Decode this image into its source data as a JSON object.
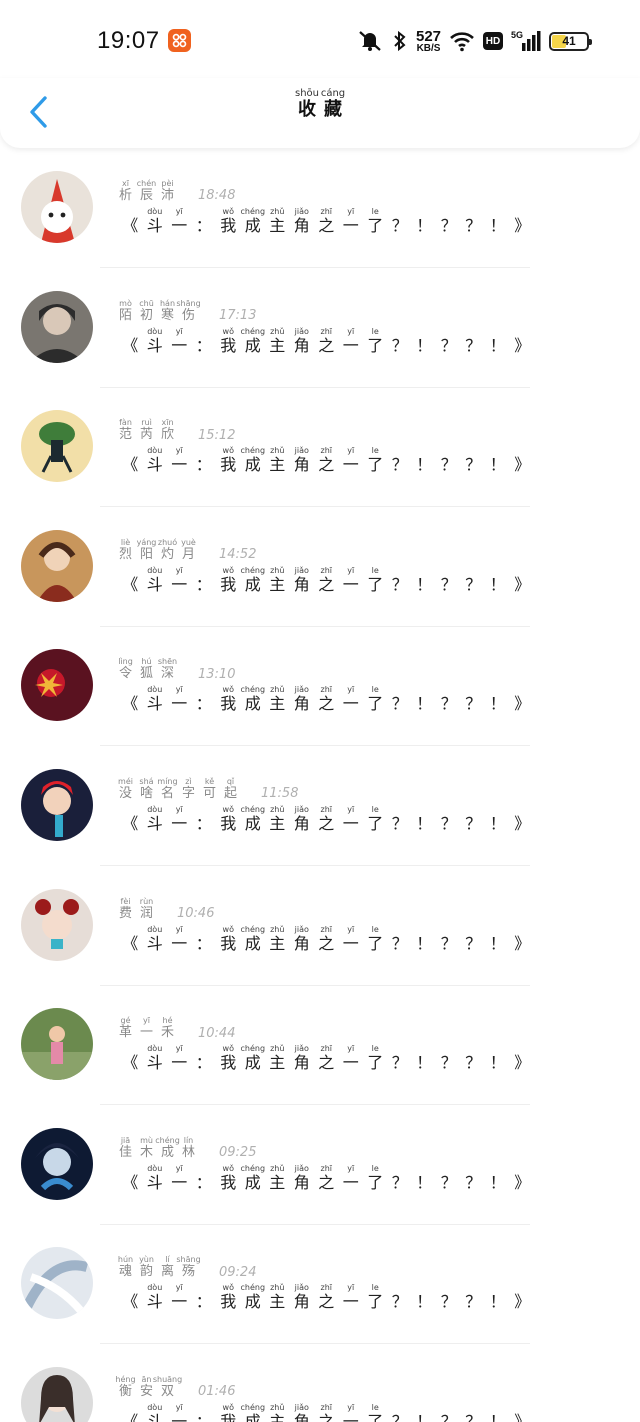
{
  "status_bar": {
    "time": "19:07",
    "net_speed_value": "527",
    "net_speed_unit": "KB/S",
    "hd_badge": "HD",
    "network_label": "5G",
    "battery_level": "41"
  },
  "header": {
    "title_chars": [
      {
        "py": "shōu",
        "hz": "收"
      },
      {
        "py": "cáng",
        "hz": "藏"
      }
    ]
  },
  "message_chars": [
    {
      "py": "",
      "hz": "《"
    },
    {
      "py": "dòu",
      "hz": "斗"
    },
    {
      "py": "yī",
      "hz": "一"
    },
    {
      "py": "",
      "hz": "："
    },
    {
      "py": "wǒ",
      "hz": "我"
    },
    {
      "py": "chéng",
      "hz": "成"
    },
    {
      "py": "zhǔ",
      "hz": "主"
    },
    {
      "py": "jiǎo",
      "hz": "角"
    },
    {
      "py": "zhī",
      "hz": "之"
    },
    {
      "py": "yī",
      "hz": "一"
    },
    {
      "py": "le",
      "hz": "了"
    },
    {
      "py": "",
      "hz": "？"
    },
    {
      "py": "",
      "hz": "！"
    },
    {
      "py": "",
      "hz": "？"
    },
    {
      "py": "",
      "hz": "？"
    },
    {
      "py": "",
      "hz": "！"
    },
    {
      "py": "",
      "hz": "》"
    }
  ],
  "favorites": [
    {
      "name": [
        {
          "py": "xī",
          "hz": "析"
        },
        {
          "py": "chén",
          "hz": "辰"
        },
        {
          "py": "pèi",
          "hz": "沛"
        }
      ],
      "time": "18:48",
      "avatar_color": "#d8392c",
      "avatar_bg": "#e9e2da"
    },
    {
      "name": [
        {
          "py": "mò",
          "hz": "陌"
        },
        {
          "py": "chū",
          "hz": "初"
        },
        {
          "py": "hán",
          "hz": "寒"
        },
        {
          "py": "shāng",
          "hz": "伤"
        }
      ],
      "time": "17:13",
      "avatar_color": "#2c2c2c",
      "avatar_bg": "#7a7670"
    },
    {
      "name": [
        {
          "py": "fàn",
          "hz": "范"
        },
        {
          "py": "ruì",
          "hz": "芮"
        },
        {
          "py": "xīn",
          "hz": "欣"
        }
      ],
      "time": "15:12",
      "avatar_color": "#3f7d3a",
      "avatar_bg": "#f2dfa8"
    },
    {
      "name": [
        {
          "py": "liè",
          "hz": "烈"
        },
        {
          "py": "yáng",
          "hz": "阳"
        },
        {
          "py": "zhuó",
          "hz": "灼"
        },
        {
          "py": "yuè",
          "hz": "月"
        }
      ],
      "time": "14:52",
      "avatar_color": "#8a2c1e",
      "avatar_bg": "#c8965c"
    },
    {
      "name": [
        {
          "py": "lìng",
          "hz": "令"
        },
        {
          "py": "hú",
          "hz": "狐"
        },
        {
          "py": "shēn",
          "hz": "深"
        }
      ],
      "time": "13:10",
      "avatar_color": "#c6182a",
      "avatar_bg": "#5a1220"
    },
    {
      "name": [
        {
          "py": "méi",
          "hz": "没"
        },
        {
          "py": "shá",
          "hz": "啥"
        },
        {
          "py": "míng",
          "hz": "名"
        },
        {
          "py": "zì",
          "hz": "字"
        },
        {
          "py": "kě",
          "hz": "可"
        },
        {
          "py": "qǐ",
          "hz": "起"
        }
      ],
      "time": "11:58",
      "avatar_color": "#e0212a",
      "avatar_bg": "#1a1f3a"
    },
    {
      "name": [
        {
          "py": "fèi",
          "hz": "费"
        },
        {
          "py": "rùn",
          "hz": "润"
        }
      ],
      "time": "10:46",
      "avatar_color": "#9b1b1b",
      "avatar_bg": "#e6ddd7"
    },
    {
      "name": [
        {
          "py": "gé",
          "hz": "革"
        },
        {
          "py": "yī",
          "hz": "一"
        },
        {
          "py": "hé",
          "hz": "禾"
        }
      ],
      "time": "10:44",
      "avatar_color": "#e48aa8",
      "avatar_bg": "#6b8a4e"
    },
    {
      "name": [
        {
          "py": "jiā",
          "hz": "佳"
        },
        {
          "py": "mù",
          "hz": "木"
        },
        {
          "py": "chéng",
          "hz": "成"
        },
        {
          "py": "lín",
          "hz": "林"
        }
      ],
      "time": "09:25",
      "avatar_color": "#3a8ccf",
      "avatar_bg": "#0e1a33"
    },
    {
      "name": [
        {
          "py": "hún",
          "hz": "魂"
        },
        {
          "py": "yùn",
          "hz": "韵"
        },
        {
          "py": "lí",
          "hz": "离"
        },
        {
          "py": "shāng",
          "hz": "殇"
        }
      ],
      "time": "09:24",
      "avatar_color": "#9fb3c8",
      "avatar_bg": "#e3e8ee"
    },
    {
      "name": [
        {
          "py": "héng",
          "hz": "衡"
        },
        {
          "py": "ān",
          "hz": "安"
        },
        {
          "py": "shuāng",
          "hz": "双"
        }
      ],
      "time": "01:46",
      "avatar_color": "#3a2e2a",
      "avatar_bg": "#dcdcdc"
    }
  ]
}
